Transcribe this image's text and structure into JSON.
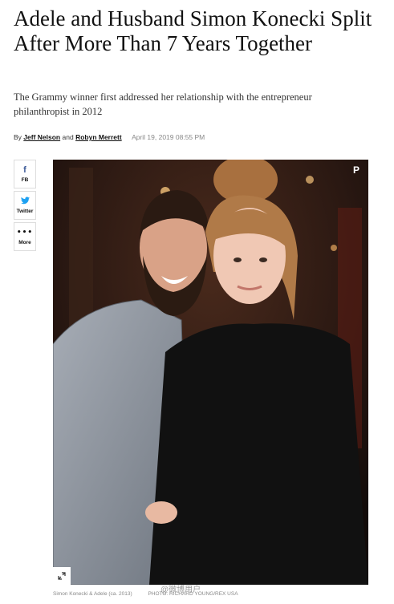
{
  "article": {
    "headline": "Adele and Husband Simon Konecki Split After More Than 7 Years Together",
    "dek": "The Grammy winner first addressed her relationship with the entrepreneur philanthropist in 2012",
    "byline": {
      "prefix": "By",
      "author1": "Jeff Nelson",
      "conjunction": "and",
      "author2": "Robyn Merrett",
      "date": "April 19, 2019 08:55 PM"
    }
  },
  "share": [
    {
      "icon": "facebook-icon",
      "glyph": "f",
      "label": "FB"
    },
    {
      "icon": "twitter-icon",
      "glyph": "🐦",
      "label": "Twitter"
    },
    {
      "icon": "more-icon",
      "glyph": "•••",
      "label": "More"
    }
  ],
  "photo": {
    "pin_glyph": "P",
    "caption": "Simon Konecki & Adele (ca. 2013)",
    "credit": "PHOTO: RICHARD YOUNG/REX USA",
    "watermark": "@微博用户"
  },
  "colors": {
    "facebook": "#3b5998",
    "twitter": "#1da1f2",
    "text": "#111111",
    "muted": "#888888"
  }
}
